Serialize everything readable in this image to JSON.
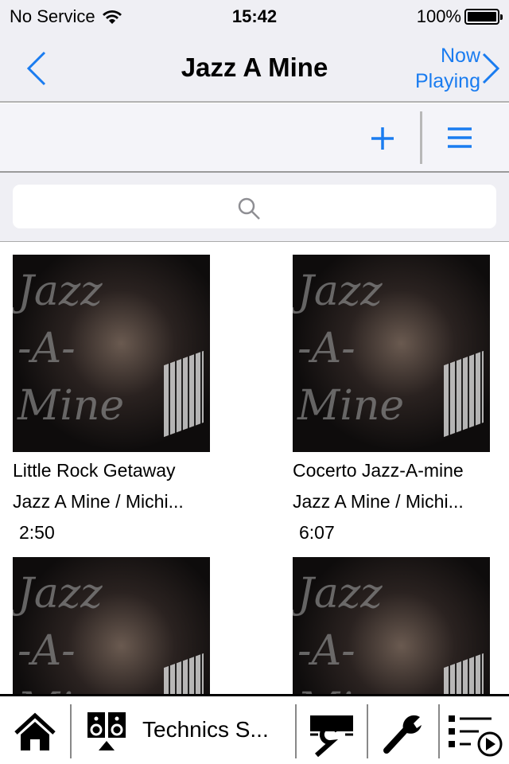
{
  "status": {
    "carrier": "No Service",
    "time": "15:42",
    "battery": "100%"
  },
  "nav": {
    "title": "Jazz A Mine",
    "now_playing_line1": "Now",
    "now_playing_line2": "Playing"
  },
  "search": {
    "placeholder": ""
  },
  "tracks": [
    {
      "title": "Little Rock Getaway",
      "subtitle": "Jazz A Mine / Michi...",
      "duration": "2:50",
      "art_text": "Jazz-A-Mine"
    },
    {
      "title": "Cocerto Jazz-A-mine",
      "subtitle": "Jazz A Mine / Michi...",
      "duration": "6:07",
      "art_text": "Jazz-A-Mine"
    },
    {
      "title": "",
      "subtitle": "",
      "duration": "",
      "art_text": "Jazz-A-Mine"
    },
    {
      "title": "",
      "subtitle": "",
      "duration": "",
      "art_text": "Jazz-A-Mine"
    }
  ],
  "tabbar": {
    "device_label": "Technics S..."
  },
  "colors": {
    "accent": "#1a7cf0",
    "bar_bg": "#efeff4"
  }
}
